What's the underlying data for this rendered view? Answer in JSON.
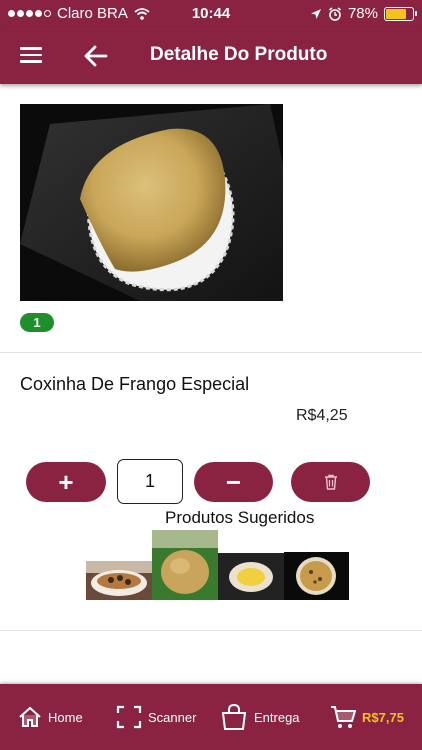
{
  "status_bar": {
    "carrier": "Claro BRA",
    "time": "10:44",
    "battery": "78%",
    "battery_level": 0.78,
    "battery_color": "#f2c318"
  },
  "header": {
    "title": "Detalhe Do Produto",
    "menu_icon": "hamburger-menu-icon",
    "back_icon": "arrow-left-icon",
    "background": "#8a2342"
  },
  "product": {
    "badge": "1",
    "name": "Coxinha De Frango Especial",
    "price": "R$4,25",
    "quantity": "1"
  },
  "controls": {
    "plus": "+",
    "minus": "−",
    "trash_icon": "trash-icon"
  },
  "suggested": {
    "title": "Produtos Sugeridos",
    "items": [
      "pudding-dish",
      "coxinha",
      "egg-tart",
      "muffin"
    ]
  },
  "bottom_nav": {
    "home": "Home",
    "scanner": "Scanner",
    "entrega": "Entrega",
    "cart_total": "R$7,75",
    "accent": "#f2c318"
  }
}
